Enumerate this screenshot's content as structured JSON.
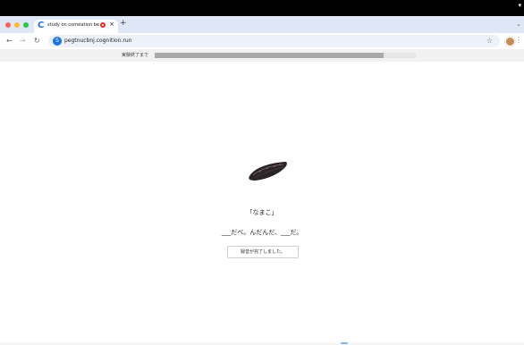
{
  "browser": {
    "tab_title": "study on correlation betw",
    "tab_favicon": "C",
    "new_tab": "+",
    "close": "×",
    "url": "pegtnucbnj.cognition.run",
    "site_badge": "S",
    "icons": [
      "back-arrow-icon",
      "forward-arrow-icon",
      "reload-icon",
      "star-icon",
      "profile-avatar",
      "kebab-menu-icon",
      "recording-icon",
      "tab-dropdown-icon"
    ]
  },
  "progress": {
    "label": "実験終了まで",
    "value": 0.875
  },
  "stimulus": {
    "image": "sea-cucumber-image",
    "word": "「なまこ」",
    "sentence": "___だべ。んだんだ、___だ。",
    "done_button": "録音が完了しました。"
  },
  "colors": {
    "tabstrip": "#dfe7f7",
    "accent": "#1a73e8",
    "progress_fill": "#a8a8a8",
    "record": "#d93025"
  }
}
